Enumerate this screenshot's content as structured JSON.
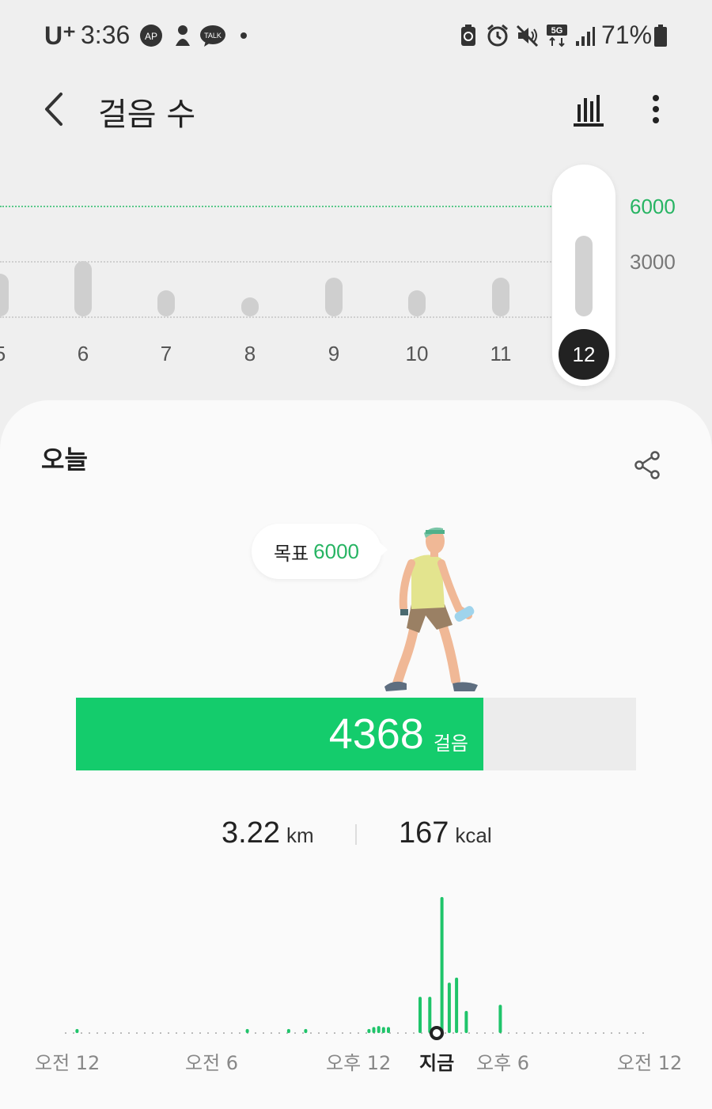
{
  "status_bar": {
    "carrier": "U⁺",
    "time": "3:36",
    "battery_percent": "71%",
    "icons": [
      "ap-app-icon",
      "person-app-icon",
      "kakaotalk-icon",
      "notification-dot-icon",
      "battery-saver-icon",
      "alarm-icon",
      "mute-icon",
      "5g-data-icon",
      "signal-icon",
      "battery-icon"
    ]
  },
  "header": {
    "back_icon": "chevron-left-icon",
    "title": "걸음 수",
    "trend_icon": "bar-chart-icon",
    "more_icon": "more-vertical-icon"
  },
  "weekly_chart": {
    "goal_label": "6000",
    "mid_label": "3000",
    "days": [
      "5",
      "6",
      "7",
      "8",
      "9",
      "10",
      "11",
      "12"
    ],
    "selected_day": "12"
  },
  "today": {
    "title": "오늘",
    "share_icon": "share-icon",
    "goal_prefix": "목표",
    "goal_value": "6000",
    "steps": "4368",
    "steps_unit": "걸음",
    "distance_value": "3.22",
    "distance_unit": "km",
    "calories_value": "167",
    "calories_unit": "kcal",
    "hour_labels": {
      "midnight": "오전 12",
      "six_am": "오전 6",
      "noon": "오후 12",
      "now": "지금",
      "six_pm": "오후 6",
      "midnight_end": "오전 12"
    }
  },
  "chart_data": [
    {
      "type": "bar",
      "categories": [
        "5",
        "6",
        "7",
        "8",
        "9",
        "10",
        "11",
        "12"
      ],
      "values": [
        2300,
        3000,
        1400,
        800,
        2100,
        1400,
        2100,
        4368
      ],
      "ylim": [
        0,
        6000
      ],
      "goal": 6000,
      "reference_lines": [
        3000,
        6000
      ],
      "selected": "12"
    },
    {
      "type": "bar",
      "categories": [
        "오전 12",
        "오전 6",
        "오후 12",
        "지금",
        "오후 6",
        "오전 12"
      ],
      "x_range_hours": [
        0,
        24
      ],
      "x_hours": [
        0.5,
        7.5,
        9.2,
        9.9,
        12.5,
        12.7,
        12.9,
        13.1,
        13.3,
        14.6,
        15.0,
        15.5,
        15.8,
        16.1,
        16.5,
        17.9
      ],
      "values": [
        40,
        40,
        40,
        40,
        40,
        60,
        70,
        60,
        60,
        360,
        360,
        1350,
        500,
        550,
        220,
        280
      ],
      "color": "#1fc46a"
    }
  ],
  "progress": {
    "fraction": 0.728,
    "color": "#14cc6c"
  }
}
